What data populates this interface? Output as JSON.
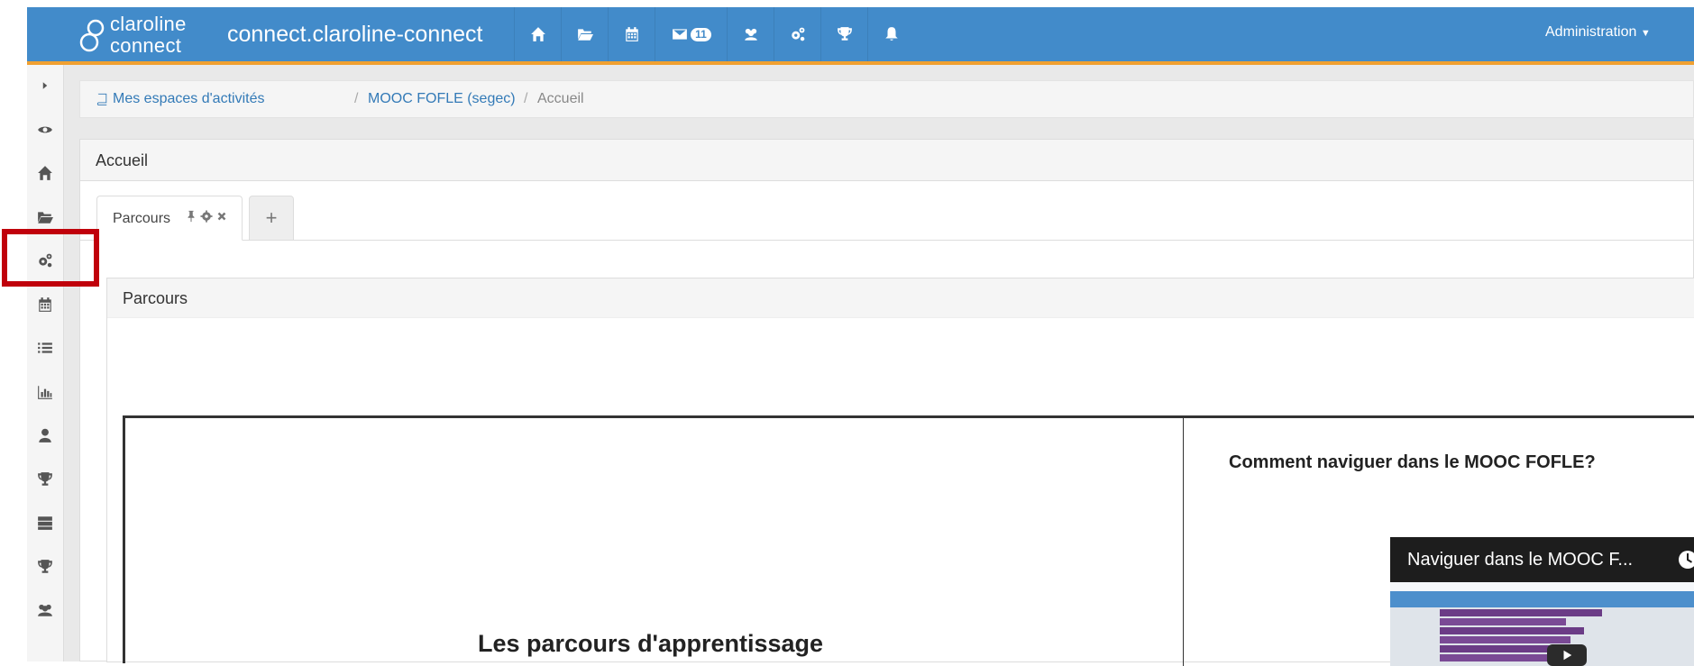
{
  "topbar": {
    "brand_line1": "claroline",
    "brand_line2": "connect",
    "site_title": "connect.claroline-connect",
    "messages_count": "11",
    "admin_label": "Administration"
  },
  "breadcrumb": {
    "items": [
      "Mes espaces d'activités",
      "MOOC FOFLE (segec)",
      "Accueil"
    ],
    "separator": "/"
  },
  "panel": {
    "title": "Accueil",
    "tabs": [
      {
        "label": "Parcours"
      }
    ],
    "add_tab_symbol": "+"
  },
  "widget": {
    "title": "Parcours",
    "left_heading": "Les parcours d'apprentissage",
    "right_heading": "Comment naviguer dans le MOOC FOFLE?",
    "video_title": "Naviguer dans le MOOC F..."
  },
  "colors": {
    "topbar": "#428bca",
    "topbar_accent": "#f0a031",
    "highlight": "#c0000b",
    "link": "#337ab7"
  },
  "icons": {
    "nav": [
      "home-icon",
      "folder-icon",
      "calendar-icon",
      "envelope-icon",
      "users-icon",
      "gears-icon",
      "trophy-icon",
      "bell-icon"
    ],
    "sidebar": [
      "caret-right-icon",
      "eye-icon",
      "home-icon",
      "folder-icon",
      "gears-icon",
      "calendar-icon",
      "list-icon",
      "bar-chart-icon",
      "user-icon",
      "trophy-icon",
      "server-icon",
      "trophy-icon",
      "users-icon"
    ]
  }
}
